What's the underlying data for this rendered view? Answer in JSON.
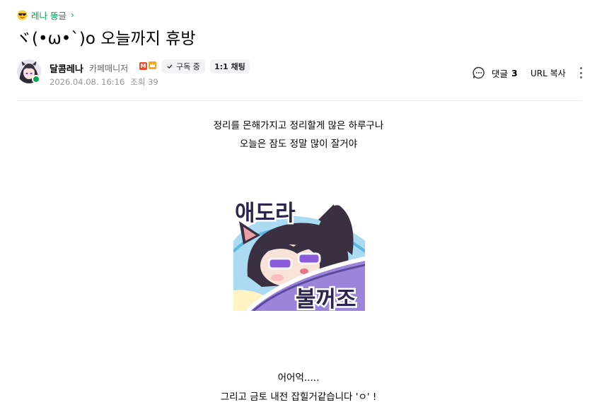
{
  "breadcrumb": {
    "board_name": "레나 똥글",
    "emoji_icon": "sunglasses-face",
    "chevron_icon": "chevron-right"
  },
  "post": {
    "title": "ヾ(•ω•`)o 오늘까지 휴방",
    "author": {
      "nickname": "달콤레나",
      "role": "카페매니저",
      "badges": [
        {
          "name": "manager-badge",
          "text": "M",
          "color": "#e54d2e"
        },
        {
          "name": "crown-badge",
          "color": "#f5a623"
        }
      ],
      "online_color": "#0aa84a"
    },
    "subscribe_label": "구독 중",
    "chat_label": "1:1 채팅",
    "date": "2026.04.08. 16:16",
    "views": "조회 39",
    "comments": {
      "label": "댓글",
      "count": "3"
    },
    "url_copy_label": "URL 복사",
    "content": {
      "paragraph1": [
        "정리를 몬해가지고 정리할게 많은 하루구나",
        "오늘은 잠도 정말 많이 잘거야"
      ],
      "sticker": {
        "top_text": "애도라",
        "bottom_text": "불꺼조",
        "colors": {
          "sky": "#aadbf2",
          "blanket": "#9b84d9",
          "pillow": "#fff3c4",
          "text": "#2d2450"
        }
      },
      "paragraph2": [
        "어어억.....",
        "그리고 금토 내전 잡힐거같습니다 'ㅇ' !"
      ]
    }
  },
  "colors": {
    "accent_green": "#03a94d",
    "meta_gray": "#979797",
    "button_bg": "#f2f3f5",
    "divider": "#ebecef"
  }
}
